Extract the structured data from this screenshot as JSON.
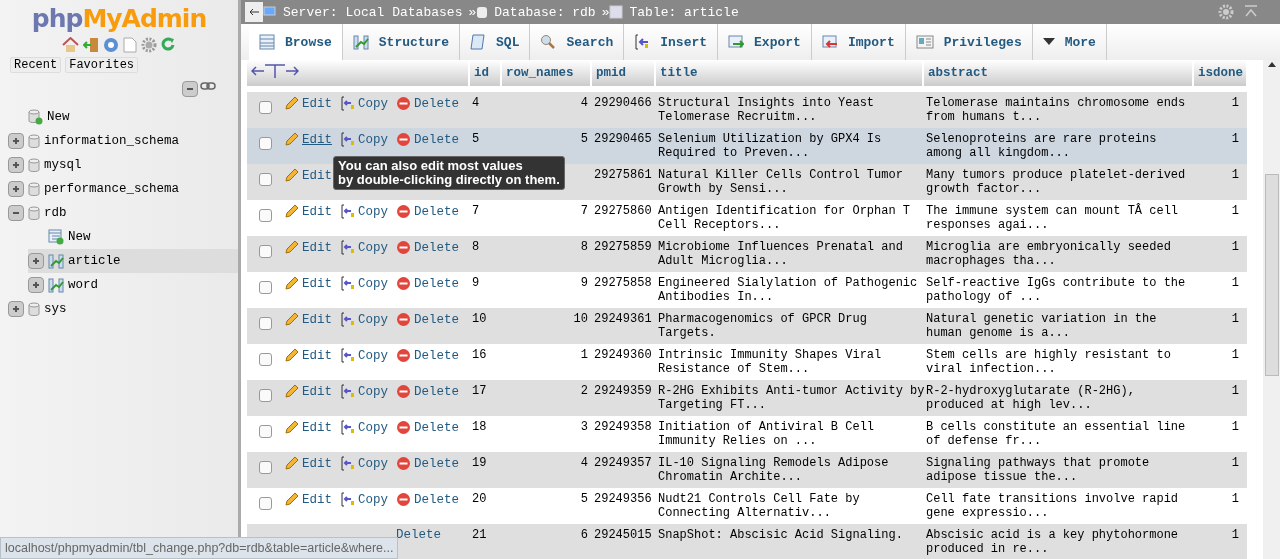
{
  "sidebar": {
    "logo": {
      "php": "php",
      "name": "MyAdmin"
    },
    "tabs": [
      {
        "label": "Recent"
      },
      {
        "label": "Favorites"
      }
    ],
    "tree": [
      {
        "label": "New",
        "kind": "new"
      },
      {
        "label": "information_schema",
        "kind": "db",
        "expanded": false
      },
      {
        "label": "mysql",
        "kind": "db",
        "expanded": false
      },
      {
        "label": "performance_schema",
        "kind": "db",
        "expanded": false
      },
      {
        "label": "rdb",
        "kind": "db",
        "expanded": true,
        "children": [
          {
            "label": "New",
            "kind": "newtable"
          },
          {
            "label": "article",
            "kind": "table",
            "expanded": false,
            "selected": true
          },
          {
            "label": "word",
            "kind": "table",
            "expanded": false,
            "selected": false
          }
        ]
      },
      {
        "label": "sys",
        "kind": "db",
        "expanded": false
      }
    ]
  },
  "breadcrumb": [
    {
      "label": "Server: Local Databases",
      "kind": "server"
    },
    {
      "label": "Database: rdb",
      "kind": "db"
    },
    {
      "label": "Table: article",
      "kind": "table"
    }
  ],
  "breadcrumb_sep": [
    "»",
    "»"
  ],
  "tabs": [
    {
      "label": "Browse",
      "selected": true,
      "kind": "browse"
    },
    {
      "label": "Structure",
      "selected": false,
      "kind": "structure"
    },
    {
      "label": "SQL",
      "selected": false,
      "kind": "sql"
    },
    {
      "label": "Search",
      "selected": false,
      "kind": "search"
    },
    {
      "label": "Insert",
      "selected": false,
      "kind": "insert"
    },
    {
      "label": "Export",
      "selected": false,
      "kind": "export"
    },
    {
      "label": "Import",
      "selected": false,
      "kind": "import"
    },
    {
      "label": "Privileges",
      "selected": false,
      "kind": "privileges"
    },
    {
      "label": "More",
      "selected": false,
      "kind": "more"
    }
  ],
  "table": {
    "columns": [
      "id",
      "row_names",
      "pmid",
      "title",
      "abstract",
      "isdone"
    ],
    "rows": [
      {
        "hovered": false,
        "actions": {
          "edit": "Edit",
          "copy": "Copy",
          "delete": "Delete"
        },
        "id": "4",
        "row_names": "4",
        "pmid": "29290466",
        "title": "Structural Insights into Yeast\nTelomerase Recruitm...",
        "abstract": "Telomerase maintains chromosome ends\nfrom humans t...",
        "isdone": "1"
      },
      {
        "hovered": true,
        "tooltip": "You can also edit most values\nby double-clicking directly on them.",
        "actions": {
          "edit": "Edit",
          "copy": "Copy",
          "delete": "Delete"
        },
        "id": "5",
        "row_names": "5",
        "pmid": "29290465",
        "title": "Selenium Utilization by GPX4 Is\nRequired to Preven...",
        "abstract": "Selenoproteins are rare proteins\namong all kingdom...",
        "isdone": "1"
      },
      {
        "hovered": false,
        "actions": {
          "edit": "Edit"
        },
        "pmid": "29275861",
        "title": "Natural Killer Cells Control Tumor\nGrowth by Sensi...",
        "abstract": "Many tumors produce platelet-derived\ngrowth factor...",
        "isdone": "1"
      },
      {
        "hovered": false,
        "actions": {
          "edit": "Edit",
          "copy": "Copy",
          "delete": "Delete"
        },
        "id": "7",
        "row_names": "7",
        "pmid": "29275860",
        "title": "Antigen Identification for Orphan T\nCell Receptors...",
        "abstract": "The immune system can mount TÂ cell\nresponses agai...",
        "isdone": "1"
      },
      {
        "hovered": false,
        "actions": {
          "edit": "Edit",
          "copy": "Copy",
          "delete": "Delete"
        },
        "id": "8",
        "row_names": "8",
        "pmid": "29275859",
        "title": "Microbiome Influences Prenatal and\nAdult Microglia...",
        "abstract": "Microglia are embryonically seeded\nmacrophages tha...",
        "isdone": "1"
      },
      {
        "hovered": false,
        "actions": {
          "edit": "Edit",
          "copy": "Copy",
          "delete": "Delete"
        },
        "id": "9",
        "row_names": "9",
        "pmid": "29275858",
        "title": "Engineered Sialylation of Pathogenic\nAntibodies In...",
        "abstract": "Self-reactive IgGs contribute to the\npathology of ...",
        "isdone": "1"
      },
      {
        "hovered": false,
        "actions": {
          "edit": "Edit",
          "copy": "Copy",
          "delete": "Delete"
        },
        "id": "10",
        "row_names": "10",
        "pmid": "29249361",
        "title": "Pharmacogenomics of GPCR Drug\nTargets.",
        "abstract": "Natural genetic variation in the\nhuman genome is a...",
        "isdone": "1"
      },
      {
        "hovered": false,
        "actions": {
          "edit": "Edit",
          "copy": "Copy",
          "delete": "Delete"
        },
        "id": "16",
        "row_names": "1",
        "pmid": "29249360",
        "title": "Intrinsic Immunity Shapes Viral\nResistance of Stem...",
        "abstract": "Stem cells are highly resistant to\nviral infection...",
        "isdone": "1"
      },
      {
        "hovered": false,
        "actions": {
          "edit": "Edit",
          "copy": "Copy",
          "delete": "Delete"
        },
        "id": "17",
        "row_names": "2",
        "pmid": "29249359",
        "title": "R-2HG Exhibits Anti-tumor Activity by\nTargeting FT...",
        "abstract": "R-2-hydroxyglutarate (R-2HG),\nproduced at high lev...",
        "isdone": "1"
      },
      {
        "hovered": false,
        "actions": {
          "edit": "Edit",
          "copy": "Copy",
          "delete": "Delete"
        },
        "id": "18",
        "row_names": "3",
        "pmid": "29249358",
        "title": "Initiation of Antiviral B Cell\nImmunity Relies on ...",
        "abstract": "B cells constitute an essential line\nof defense fr...",
        "isdone": "1"
      },
      {
        "hovered": false,
        "actions": {
          "edit": "Edit",
          "copy": "Copy",
          "delete": "Delete"
        },
        "id": "19",
        "row_names": "4",
        "pmid": "29249357",
        "title": "IL-10 Signaling Remodels Adipose\nChromatin Archite...",
        "abstract": "Signaling pathways that promote\nadipose tissue the...",
        "isdone": "1"
      },
      {
        "hovered": false,
        "actions": {
          "edit": "Edit",
          "copy": "Copy",
          "delete": "Delete"
        },
        "id": "20",
        "row_names": "5",
        "pmid": "29249356",
        "title": "Nudt21 Controls Cell Fate by\nConnecting Alternativ...",
        "abstract": "Cell fate transitions involve rapid\ngene expressio...",
        "isdone": "1"
      },
      {
        "hovered": false,
        "actions": {
          "delete": "Delete"
        },
        "id": "21",
        "row_names": "6",
        "pmid": "29245015",
        "title": "SnapShot: Abscisic Acid Signaling.",
        "abstract": "Abscisic acid is a key phytohormone\nproduced in re...",
        "isdone": "1"
      }
    ]
  },
  "status_bar": "localhost/phpmyadmin/tbl_change.php?db=rdb&table=article&where..."
}
